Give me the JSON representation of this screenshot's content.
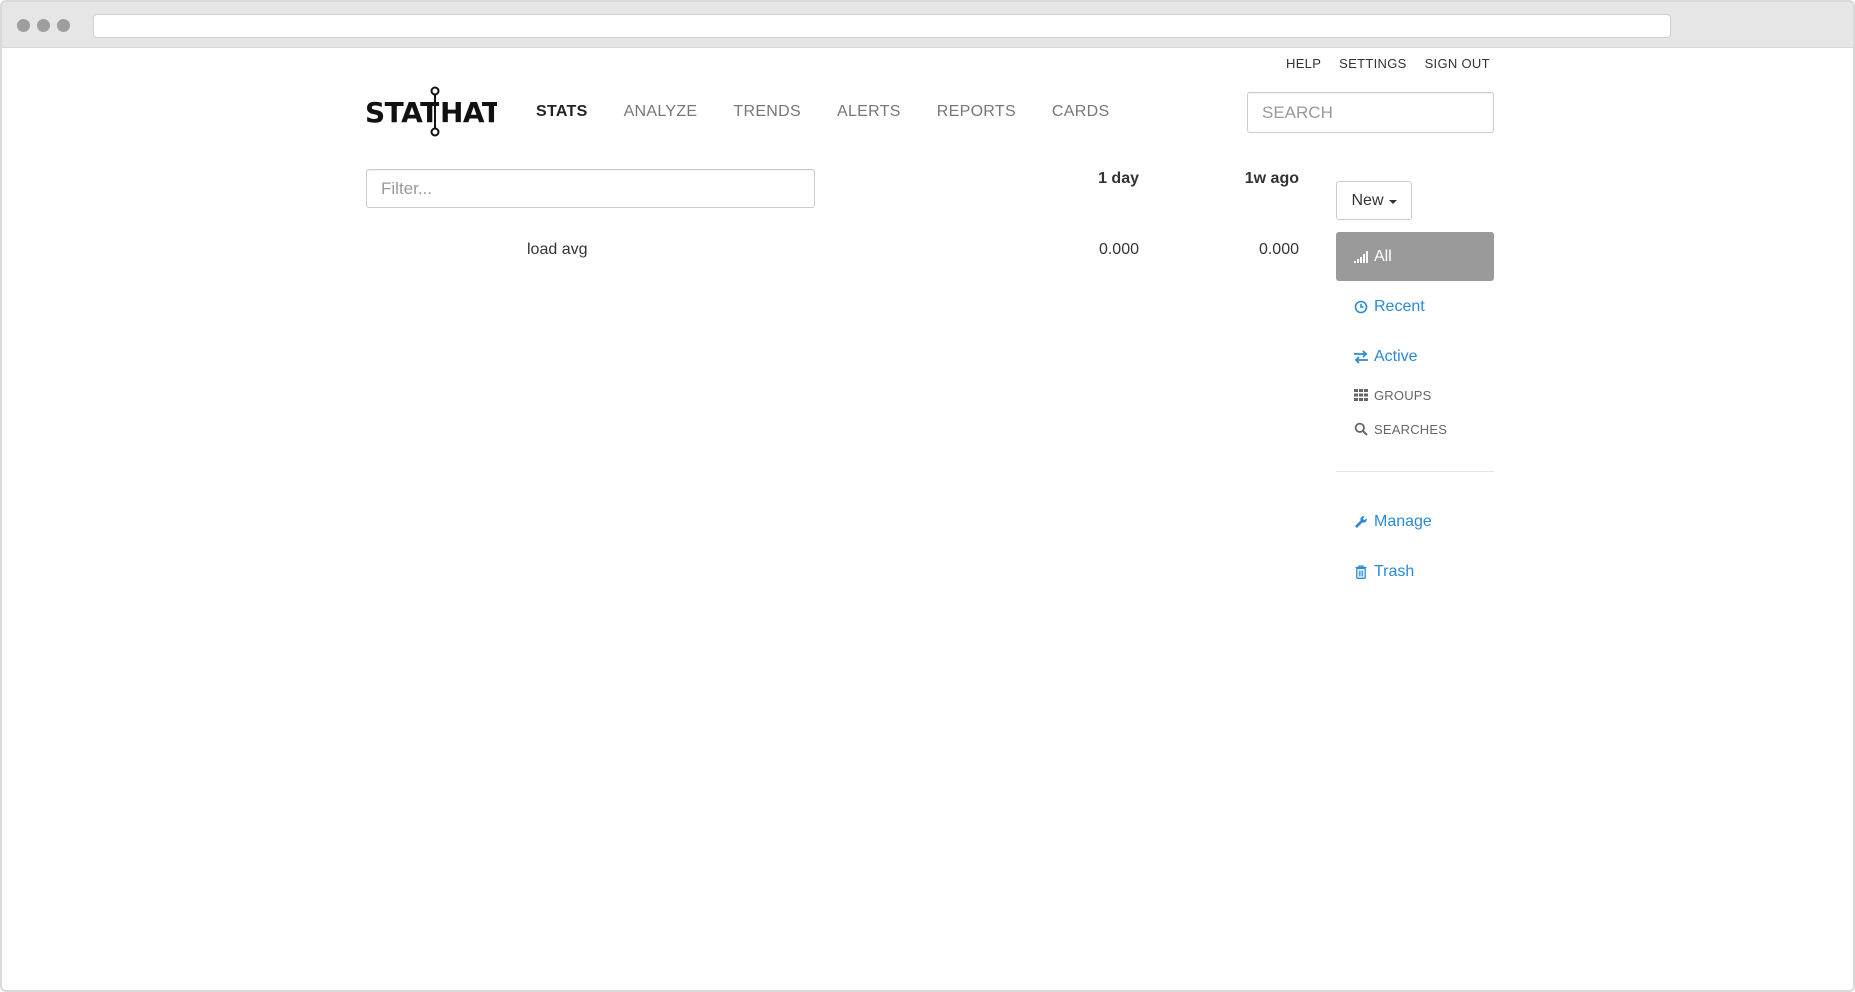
{
  "util_links": [
    "HELP",
    "SETTINGS",
    "SIGN OUT"
  ],
  "logo": {
    "text_left": "STAT",
    "text_right": "HAT"
  },
  "nav": {
    "items": [
      {
        "label": "STATS",
        "active": true
      },
      {
        "label": "ANALYZE",
        "active": false
      },
      {
        "label": "TRENDS",
        "active": false
      },
      {
        "label": "ALERTS",
        "active": false
      },
      {
        "label": "REPORTS",
        "active": false
      },
      {
        "label": "CARDS",
        "active": false
      }
    ]
  },
  "search": {
    "placeholder": "SEARCH"
  },
  "filter": {
    "placeholder": "Filter..."
  },
  "table": {
    "columns": [
      "1 day",
      "1w ago"
    ],
    "rows": [
      {
        "name": "load avg",
        "day": "0.000",
        "week": "0.000"
      }
    ]
  },
  "sidebar": {
    "new_label": "New",
    "items": [
      {
        "label": "All",
        "icon": "signal-icon",
        "active": true
      },
      {
        "label": "Recent",
        "icon": "clock-icon"
      },
      {
        "label": "Active",
        "icon": "swap-arrows-icon"
      },
      {
        "label": "GROUPS",
        "icon": "grid-icon"
      },
      {
        "label": "SEARCHES",
        "icon": "search-icon"
      }
    ],
    "footer_items": [
      {
        "label": "Manage",
        "icon": "wrench-icon"
      },
      {
        "label": "Trash",
        "icon": "trash-icon"
      }
    ]
  },
  "colors": {
    "accent": "#2a8ad4",
    "active_bg": "#9a9a9a"
  }
}
